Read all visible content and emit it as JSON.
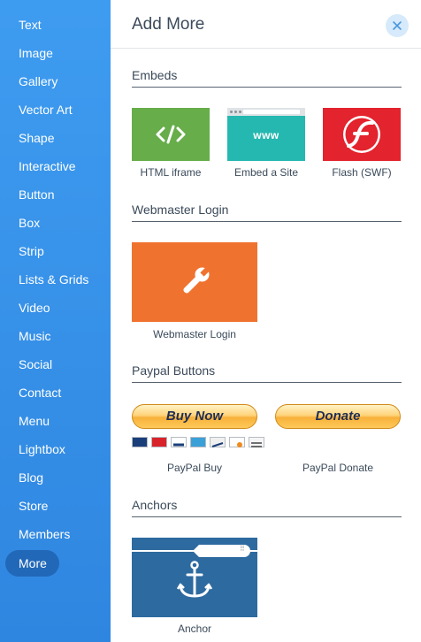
{
  "sidebar": {
    "items": [
      {
        "label": "Text"
      },
      {
        "label": "Image"
      },
      {
        "label": "Gallery"
      },
      {
        "label": "Vector Art"
      },
      {
        "label": "Shape"
      },
      {
        "label": "Interactive"
      },
      {
        "label": "Button"
      },
      {
        "label": "Box"
      },
      {
        "label": "Strip"
      },
      {
        "label": "Lists & Grids"
      },
      {
        "label": "Video"
      },
      {
        "label": "Music"
      },
      {
        "label": "Social"
      },
      {
        "label": "Contact"
      },
      {
        "label": "Menu"
      },
      {
        "label": "Lightbox"
      },
      {
        "label": "Blog"
      },
      {
        "label": "Store"
      },
      {
        "label": "Members"
      },
      {
        "label": "More"
      }
    ],
    "selected": "More"
  },
  "panel": {
    "title": "Add More",
    "close_icon": "close-icon",
    "sections": {
      "embeds": {
        "title": "Embeds",
        "items": [
          {
            "label": "HTML iframe",
            "icon": "code-icon",
            "color": "#67ad4a",
            "glyph": "</>"
          },
          {
            "label": "Embed a Site",
            "icon": "browser-icon",
            "color": "#25b8b0",
            "glyph": "www"
          },
          {
            "label": "Flash (SWF)",
            "icon": "flash-icon",
            "color": "#e3232d"
          }
        ]
      },
      "webmaster": {
        "title": "Webmaster Login",
        "items": [
          {
            "label": "Webmaster Login",
            "icon": "wrench-icon",
            "color": "#f0722f"
          }
        ]
      },
      "paypal": {
        "title": "Paypal Buttons",
        "items": [
          {
            "label": "PayPal Buy",
            "button_text": "Buy Now",
            "card_logos": [
              "MASTERCARD",
              "MAESTRO",
              "VISA",
              "AMEX",
              "ECHECK",
              "DISCOVER",
              "BANK"
            ]
          },
          {
            "label": "PayPal Donate",
            "button_text": "Donate"
          }
        ]
      },
      "anchors": {
        "title": "Anchors",
        "items": [
          {
            "label": "Anchor",
            "icon": "anchor-icon",
            "color": "#2d6a9f"
          }
        ]
      }
    }
  },
  "colors": {
    "sidebar_top": "#3e9cf0",
    "sidebar_bottom": "#2f86e0",
    "selected_pill": "#2268b8",
    "text": "#3b4a5a"
  }
}
